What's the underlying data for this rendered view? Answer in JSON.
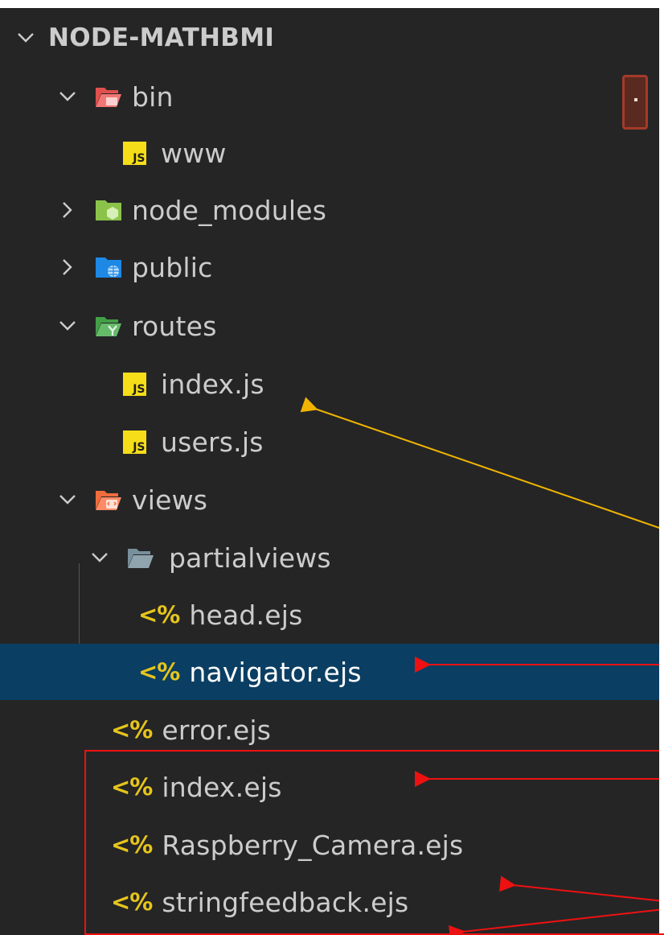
{
  "explorer": {
    "section_title": "NODE-MATHBMI",
    "items": [
      {
        "label": "bin",
        "kind": "folder",
        "icon": "bin-folder-open-icon",
        "expanded": true,
        "depth": 1
      },
      {
        "label": "www",
        "kind": "js",
        "icon": "javascript-file-icon",
        "icon_text": "JS",
        "depth": 2
      },
      {
        "label": "node_modules",
        "kind": "folder",
        "icon": "node-folder-icon",
        "expanded": false,
        "depth": 1
      },
      {
        "label": "public",
        "kind": "folder",
        "icon": "public-folder-icon",
        "expanded": false,
        "depth": 1
      },
      {
        "label": "routes",
        "kind": "folder",
        "icon": "routes-folder-open-icon",
        "expanded": true,
        "depth": 1
      },
      {
        "label": "index.js",
        "kind": "js",
        "icon": "javascript-file-icon",
        "icon_text": "JS",
        "depth": 2
      },
      {
        "label": "users.js",
        "kind": "js",
        "icon": "javascript-file-icon",
        "icon_text": "JS",
        "depth": 2
      },
      {
        "label": "views",
        "kind": "folder",
        "icon": "views-folder-open-icon",
        "expanded": true,
        "depth": 1
      },
      {
        "label": "partialviews",
        "kind": "folder",
        "icon": "folder-open-icon",
        "expanded": true,
        "depth": 2
      },
      {
        "label": "head.ejs",
        "kind": "ejs",
        "icon": "ejs-file-icon",
        "icon_text": "<%",
        "depth": 3
      },
      {
        "label": "navigator.ejs",
        "kind": "ejs",
        "icon": "ejs-file-icon",
        "icon_text": "<%",
        "depth": 3,
        "selected": true
      },
      {
        "label": "error.ejs",
        "kind": "ejs",
        "icon": "ejs-file-icon",
        "icon_text": "<%",
        "depth": 2
      },
      {
        "label": "index.ejs",
        "kind": "ejs",
        "icon": "ejs-file-icon",
        "icon_text": "<%",
        "depth": 2
      },
      {
        "label": "Raspberry_Camera.ejs",
        "kind": "ejs",
        "icon": "ejs-file-icon",
        "icon_text": "<%",
        "depth": 2
      },
      {
        "label": "stringfeedback.ejs",
        "kind": "ejs",
        "icon": "ejs-file-icon",
        "icon_text": "<%",
        "depth": 2
      }
    ]
  },
  "colors": {
    "background": "#252526",
    "selection": "#0b3e63",
    "text": "#cccccc",
    "js_badge": "#f5de19",
    "ejs_glyph": "#e6c51c",
    "annotation_yellow": "#f0b400",
    "annotation_red": "#ee1111"
  }
}
